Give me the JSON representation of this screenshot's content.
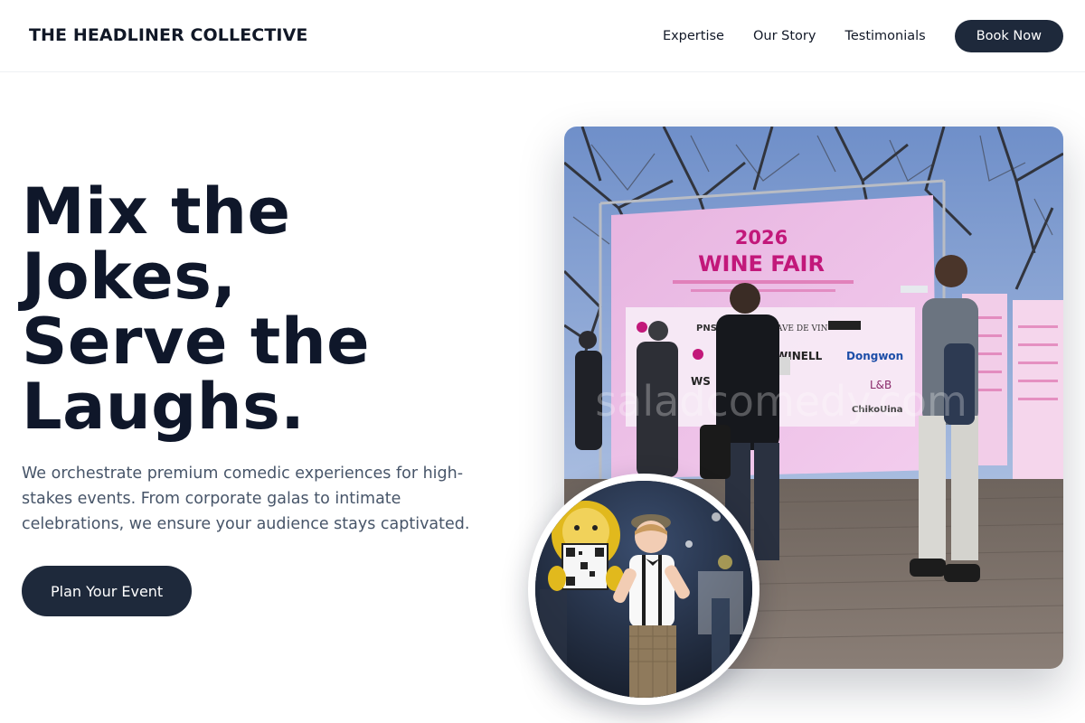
{
  "header": {
    "brand": "THE HEADLINER COLLECTIVE",
    "nav": [
      {
        "label": "Expertise"
      },
      {
        "label": "Our Story"
      },
      {
        "label": "Testimonials"
      }
    ],
    "cta_label": "Book Now"
  },
  "hero": {
    "title_lines": [
      "Mix the",
      "Jokes,",
      "Serve the",
      "Laughs."
    ],
    "subtitle": "We orchestrate premium comedic experiences for high-stakes events. From corporate galas to intimate celebrations, we ensure your audience stays captivated.",
    "cta_label": "Plan Your Event"
  },
  "photos": {
    "main": {
      "banner_year": "2026",
      "banner_title": "WINE FAIR",
      "sponsor_labels": [
        "PNS",
        "CAVE DE VIN",
        "WINELL",
        "Dongwon",
        "WS",
        "L&B",
        "ChikoUina"
      ],
      "watermark": "saladcomedy.com"
    }
  },
  "colors": {
    "primary_dark": "#1e293b",
    "text_dark": "#0f172a",
    "text_muted": "#475569",
    "banner_pink": "#f0c6e8",
    "banner_text": "#c2187a"
  }
}
